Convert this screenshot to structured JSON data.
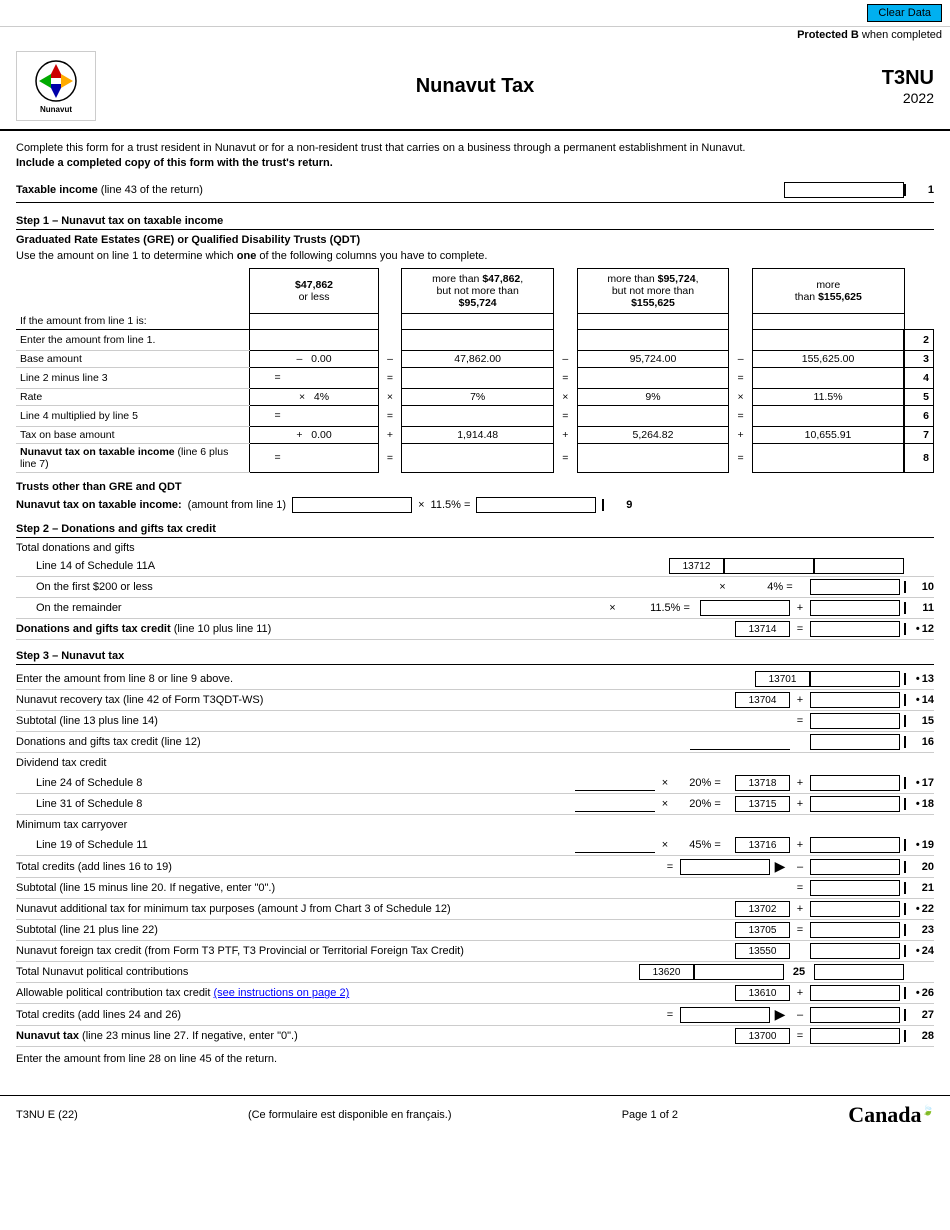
{
  "topbar": {
    "clear_data_label": "Clear Data",
    "protected_label": "Protected B",
    "protected_suffix": " when completed"
  },
  "header": {
    "form_code": "T3NU",
    "form_year": "2022",
    "form_title": "Nunavut Tax"
  },
  "instructions": {
    "line1": "Complete this form for a trust resident in Nunavut or for a non-resident trust that carries on a business through a permanent establishment in Nunavut.",
    "line2": "Include a completed copy of this form with the trust's return."
  },
  "taxable_income": {
    "label": "Taxable income",
    "sublabel": "(line 43 of the return)",
    "line_number": "1"
  },
  "step1": {
    "title": "Step 1 – Nunavut tax on taxable income",
    "subtitle": "Graduated Rate Estates (GRE) or Qualified Disability Trusts (QDT)",
    "instruction": "Use the amount on line 1 to determine which one of the following columns you have to complete.",
    "col_headers": [
      "$47,862 or less",
      "more than $47,862, but not more than $95,724",
      "more than $95,724, but not more than $155,625",
      "more than $155,625"
    ],
    "rows": [
      {
        "label": "If the amount from line 1 is:",
        "values": [
          "",
          "",
          "",
          ""
        ],
        "line": ""
      },
      {
        "label": "Enter the amount from line 1.",
        "values": [
          "",
          "",
          "",
          ""
        ],
        "line": "2"
      },
      {
        "label": "Base amount",
        "op": "–",
        "values": [
          "0.00",
          "47,862.00",
          "95,724.00",
          "155,625.00"
        ],
        "line": "3"
      },
      {
        "label": "Line 2 minus line 3",
        "op": "=",
        "values": [
          "",
          "",
          "",
          ""
        ],
        "line": "4"
      },
      {
        "label": "Rate",
        "op": "×",
        "values": [
          "4%",
          "7%",
          "9%",
          "11.5%"
        ],
        "line": "5"
      },
      {
        "label": "Line 4 multiplied by line 5",
        "op": "=",
        "values": [
          "",
          "",
          "",
          ""
        ],
        "line": "6"
      },
      {
        "label": "Tax on base amount",
        "op": "+",
        "values": [
          "0.00",
          "1,914.48",
          "5,264.82",
          "10,655.91"
        ],
        "line": "7"
      },
      {
        "label": "Nunavut tax on taxable income (line 6 plus line 7)",
        "op": "=",
        "values": [
          "",
          "",
          "",
          ""
        ],
        "line": "8",
        "bold": true
      }
    ]
  },
  "trusts_other": {
    "title": "Trusts other than GRE and QDT",
    "label": "Nunavut tax on taxable income:",
    "amount_from": "(amount from line 1)",
    "operator": "×",
    "rate": "11.5% =",
    "line": "9"
  },
  "step2": {
    "title": "Step 2 – Donations and gifts tax credit",
    "total_label": "Total donations and gifts",
    "rows": [
      {
        "label": "Line 14 of Schedule 11A",
        "code": "13712",
        "line": ""
      },
      {
        "label": "On the first $200 or less",
        "op_mid": "×",
        "rate": "4% =",
        "line": "10"
      },
      {
        "label": "On the remainder",
        "op_mid": "×",
        "rate": "11.5% =",
        "op_right": "+",
        "line": "11"
      },
      {
        "label": "Donations and gifts tax credit (line 10 plus line 11)",
        "code": "13714",
        "op_right": "=",
        "line": "• 12",
        "bold": true
      }
    ]
  },
  "step3": {
    "title": "Step 3 – Nunavut tax",
    "rows": [
      {
        "label": "Enter the amount from line 8 or line 9 above.",
        "code": "13701",
        "line": "• 13"
      },
      {
        "label": "Nunavut recovery tax (line 42 of Form T3QDT-WS)",
        "code": "13704",
        "op": "+",
        "line": "• 14"
      },
      {
        "label": "Subtotal (line 13 plus line 14)",
        "op": "=",
        "line": "15"
      },
      {
        "label": "Donations and gifts tax credit (line 12)",
        "line": "16",
        "blank_input": true
      },
      {
        "label": "Dividend tax credit",
        "line": "",
        "is_header": true
      },
      {
        "label": "Line 24 of Schedule 8",
        "op_mid": "×",
        "rate": "20% =",
        "code": "13718",
        "op_right": "+",
        "line": "• 17",
        "indent": true
      },
      {
        "label": "Line 31 of Schedule 8",
        "op_mid": "×",
        "rate": "20% =",
        "code": "13715",
        "op_right": "+",
        "line": "• 18",
        "indent": true
      },
      {
        "label": "Minimum tax carryover",
        "line": "",
        "is_header": true
      },
      {
        "label": "Line 19 of Schedule 11",
        "op_mid": "×",
        "rate": "45% =",
        "code": "13716",
        "op_right": "+",
        "line": "• 19",
        "indent": true
      },
      {
        "label": "Total credits (add lines 16 to 19)",
        "op": "=",
        "arrow": true,
        "op_right": "–",
        "line": "20"
      },
      {
        "label": "Subtotal (line 15 minus line 20. If negative, enter \"0\".)",
        "op_right": "=",
        "line": "21"
      },
      {
        "label": "Nunavut additional tax for minimum tax purposes (amount J from Chart 3 of Schedule 12)",
        "code": "13702",
        "op": "+",
        "line": "• 22"
      },
      {
        "label": "Subtotal (line 21 plus line 22)",
        "code": "13705",
        "op": "=",
        "line": "23"
      },
      {
        "label": "Nunavut foreign tax credit (from Form T3 PTF, T3 Provincial or Territorial Foreign Tax Credit)",
        "code": "13550",
        "line": "• 24"
      },
      {
        "label": "Total Nunavut political contributions",
        "code": "13620",
        "line": "25",
        "right_label": "25"
      },
      {
        "label": "Allowable political contribution tax credit (see instructions on page 2)",
        "code": "13610",
        "op": "+",
        "line": "• 26",
        "link": true
      },
      {
        "label": "Total credits (add lines 24 and 26)",
        "op": "=",
        "arrow": true,
        "op_right": "–",
        "line": "27"
      },
      {
        "label": "Nunavut tax (line 23 minus line 27. If negative, enter \"0\".)",
        "code": "13700",
        "op": "=",
        "line": "28",
        "bold": true
      }
    ]
  },
  "footer": {
    "form_id": "T3NU E (22)",
    "french_note": "(Ce formulaire est disponible en français.)",
    "page": "Page 1 of 2",
    "canada_text": "Canadä"
  }
}
